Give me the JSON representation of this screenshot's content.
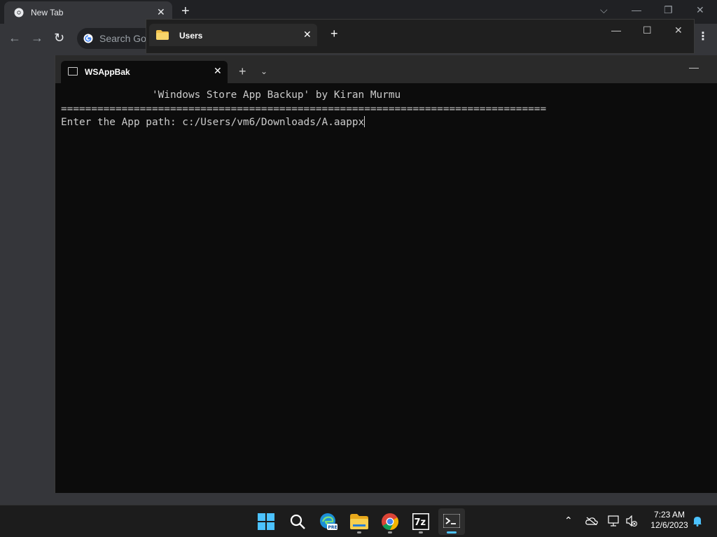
{
  "chrome": {
    "tab_title": "New Tab",
    "omnibox_placeholder": "Search Google or type a URL",
    "omnibox_visible": "Search Goo"
  },
  "explorer": {
    "tab_title": "Users"
  },
  "terminal": {
    "tab_title": "WSAppBak",
    "lines": [
      "               'Windows Store App Backup' by Kiran Murmu",
      "================================================================================",
      "Enter the App path: c:/Users/vm6/Downloads/A.aappx"
    ]
  },
  "taskbar": {
    "apps": [
      "start-icon",
      "search-icon",
      "edge-preview-icon",
      "file-explorer-icon",
      "chrome-icon",
      "7zip-icon",
      "terminal-icon"
    ],
    "time": "7:23 AM",
    "date": "12/6/2023"
  },
  "colors": {
    "terminal_bg": "#0c0c0c",
    "terminal_text": "#cccccc",
    "accent": "#4cc2ff",
    "folder": "#f0c04a"
  }
}
